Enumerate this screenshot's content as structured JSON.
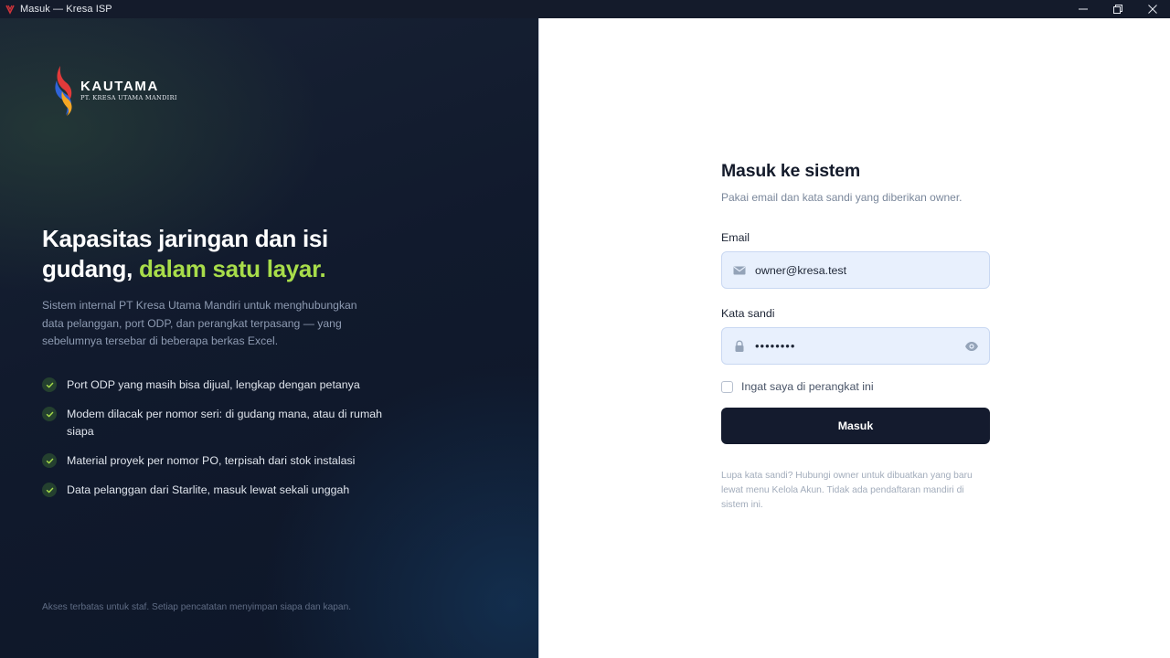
{
  "window": {
    "title": "Masuk — Kresa ISP"
  },
  "brand": {
    "name": "KAUTAMA",
    "tagline": "PT. KRESA UTAMA MANDIRI"
  },
  "hero": {
    "headline_part1": "Kapasitas jaringan dan isi gudang,",
    "headline_highlight": "dalam satu layar.",
    "lead": "Sistem internal PT Kresa Utama Mandiri untuk menghubungkan data pelanggan, port ODP, dan perangkat terpasang — yang sebelumnya tersebar di beberapa berkas Excel.",
    "features": [
      "Port ODP yang masih bisa dijual, lengkap dengan petanya",
      "Modem dilacak per nomor seri: di gudang mana, atau di rumah siapa",
      "Material proyek per nomor PO, terpisah dari stok instalasi",
      "Data pelanggan dari Starlite, masuk lewat sekali unggah"
    ],
    "footnote": "Akses terbatas untuk staf. Setiap pencatatan menyimpan siapa dan kapan."
  },
  "login": {
    "title": "Masuk ke sistem",
    "subtitle": "Pakai email dan kata sandi yang diberikan owner.",
    "email_label": "Email",
    "email_value": "owner@kresa.test",
    "password_label": "Kata sandi",
    "password_mask": "••••••••",
    "remember_label": "Ingat saya di perangkat ini",
    "remember_checked": false,
    "submit_label": "Masuk",
    "help_text": "Lupa kata sandi? Hubungi owner untuk dibuatkan yang baru lewat menu Kelola Akun. Tidak ada pendaftaran mandiri di sistem ini."
  },
  "colors": {
    "accent_green": "#a8dd4a",
    "button_dark": "#141b2e",
    "input_bg": "#e8f0fd"
  }
}
